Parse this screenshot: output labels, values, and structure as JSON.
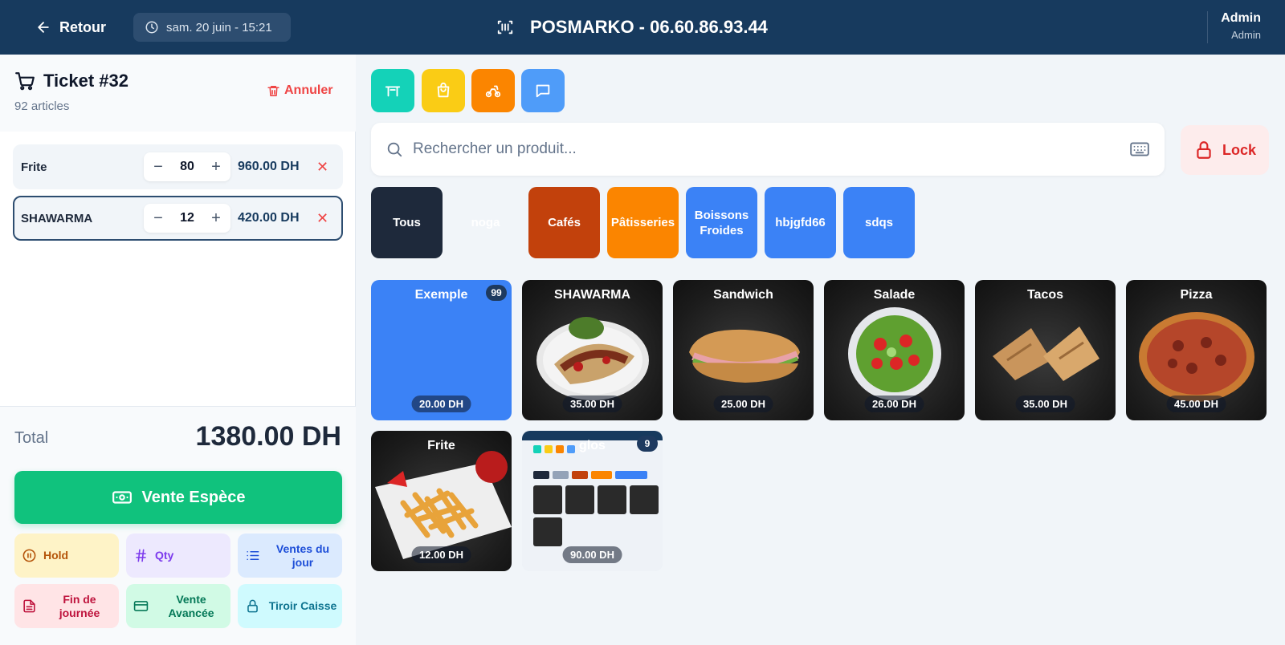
{
  "header": {
    "back_label": "Retour",
    "datetime": "sam. 20 juin - 15:21",
    "brand": "POSMARKO - 06.60.86.93.44",
    "user_name": "Admin",
    "user_role": "Admin"
  },
  "ticket": {
    "title": "Ticket #32",
    "count": "92 articles",
    "cancel_label": "Annuler",
    "lines": [
      {
        "name": "Frite",
        "qty": "80",
        "price": "960.00 DH",
        "minus": "−",
        "plus": "+",
        "remove": "✕"
      },
      {
        "name": "SHAWARMA",
        "qty": "12",
        "price": "420.00 DH",
        "minus": "−",
        "plus": "+",
        "remove": "✕"
      }
    ],
    "total_label": "Total",
    "total_value": "1380.00 DH",
    "pay_label": "Vente Espèce"
  },
  "actions": {
    "hold": "Hold",
    "qty": "Qty",
    "ventes_line1": "Ventes du",
    "ventes_line2": "jour",
    "fin_line1": "Fin de",
    "fin_line2": "journée",
    "avancee_line1": "Vente",
    "avancee_line2": "Avancée",
    "tiroir": "Tiroir Caisse"
  },
  "quick_actions": [
    {
      "icon": "table-icon",
      "color": "#14d2b8"
    },
    {
      "icon": "shopping-bag-icon",
      "color": "#facc15"
    },
    {
      "icon": "delivery-scooter-icon",
      "color": "#fb8500"
    },
    {
      "icon": "message-icon",
      "color": "#4f9cf9"
    }
  ],
  "search": {
    "placeholder": "Rechercher un produit..."
  },
  "lock_label": "Lock",
  "categories": [
    {
      "label": "Tous",
      "color": "#1e293b"
    },
    {
      "label": "noga",
      "color": "#ffffff"
    },
    {
      "label": "Cafés",
      "color": "#c2410c"
    },
    {
      "label": "Pâtisseries",
      "color": "#fb8500"
    },
    {
      "label_line1": "Boissons",
      "label_line2": "Froides",
      "color": "#3b82f6"
    },
    {
      "label": "hbjgfd66",
      "color": "#3b82f6"
    },
    {
      "label": "sdqs",
      "color": "#3b82f6"
    }
  ],
  "products": [
    {
      "name": "Exemple",
      "price": "20.00 DH",
      "badge": "99",
      "color": "#3b82f6"
    },
    {
      "name": "SHAWARMA",
      "price": "35.00 DH"
    },
    {
      "name": "Sandwich",
      "price": "25.00 DH"
    },
    {
      "name": "Salade",
      "price": "26.00 DH"
    },
    {
      "name": "Tacos",
      "price": "35.00 DH"
    },
    {
      "name": "Pizza",
      "price": "45.00 DH"
    },
    {
      "name": "Frite",
      "price": "12.00 DH"
    },
    {
      "name": "glos",
      "price": "90.00 DH",
      "badge": "9"
    }
  ]
}
